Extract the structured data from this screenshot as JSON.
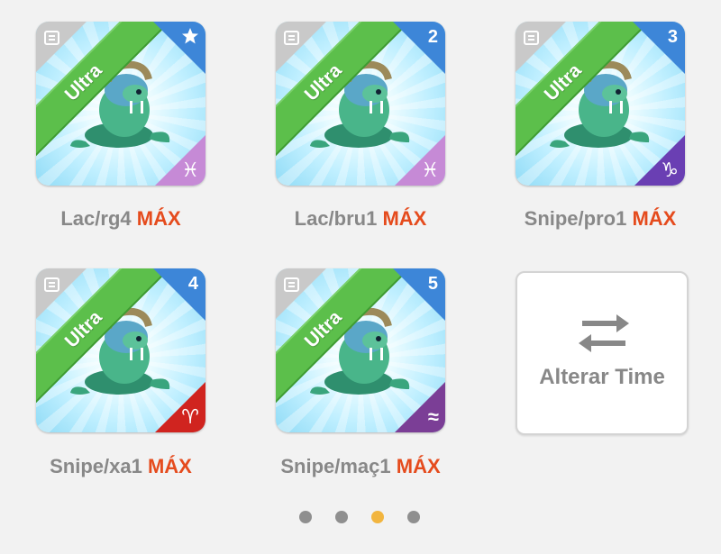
{
  "cards": [
    {
      "rarity": "Ultra",
      "badge": "",
      "badge_icon": "star-icon",
      "zodiac_icon": "pisces-icon",
      "zodiac_glyph": "♓",
      "name": "Lac/rg4",
      "level": "MÁX"
    },
    {
      "rarity": "Ultra",
      "badge": "2",
      "zodiac_icon": "pisces-icon",
      "zodiac_glyph": "♓",
      "name": "Lac/bru1",
      "level": "MÁX"
    },
    {
      "rarity": "Ultra",
      "badge": "3",
      "zodiac_icon": "capricorn-icon",
      "zodiac_glyph": "♑",
      "name": "Snipe/pro1",
      "level": "MÁX"
    },
    {
      "rarity": "Ultra",
      "badge": "4",
      "zodiac_icon": "aries-icon",
      "zodiac_glyph": "♈",
      "name": "Snipe/xa1",
      "level": "MÁX"
    },
    {
      "rarity": "Ultra",
      "badge": "5",
      "zodiac_icon": "aquarius-icon",
      "zodiac_glyph": "≈",
      "name": "Snipe/maç1",
      "level": "MÁX"
    }
  ],
  "swap": {
    "label": "Alterar Time",
    "icon": "swap-arrows-icon"
  },
  "pagination": {
    "pages": 4,
    "active_page": 3
  },
  "colors": {
    "ultra_green": "#5cbf4b",
    "badge_blue": "#3d86d8",
    "max_orange": "#e54b1d",
    "dot_active": "#f2b53f"
  }
}
